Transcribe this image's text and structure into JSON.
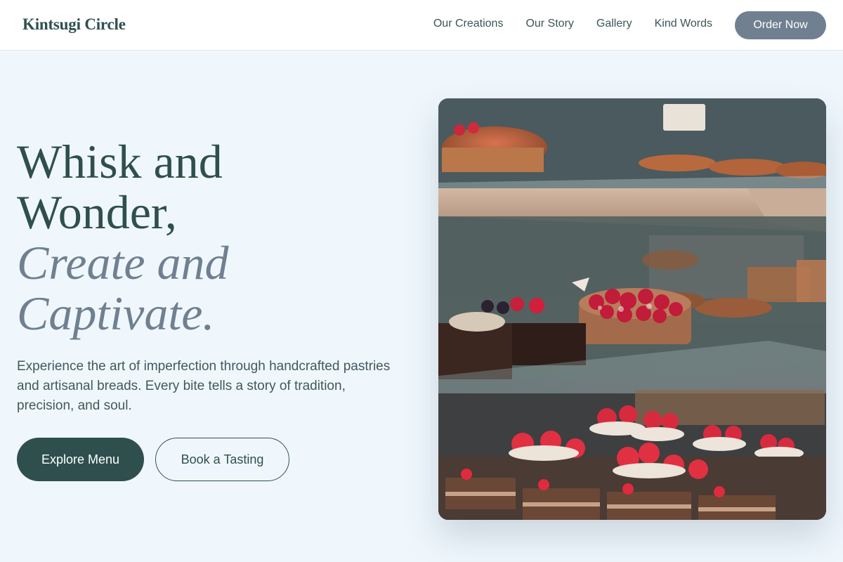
{
  "header": {
    "brand": "Kintsugi Circle",
    "nav": [
      "Our Creations",
      "Our Story",
      "Gallery",
      "Kind Words"
    ],
    "cta": "Order Now"
  },
  "hero": {
    "title_line1": "Whisk and",
    "title_line2": "Wonder,",
    "title_line3": "Create and",
    "title_line4": "Captivate.",
    "description": "Experience the art of imperfection through handcrafted pastries and artisanal breads. Every bite tells a story of tradition, precision, and soul.",
    "primary_button": "Explore Menu",
    "secondary_button": "Book a Tasting",
    "image_icon": "pastry-display-photo"
  },
  "colors": {
    "primary": "#2f4f4f",
    "accent": "#708090",
    "background": "#eff7fd"
  }
}
